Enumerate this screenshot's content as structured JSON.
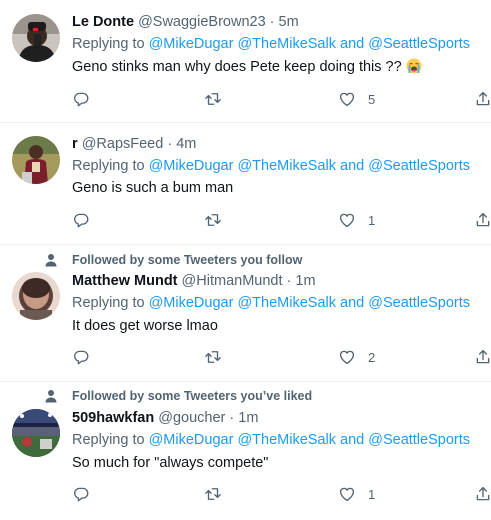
{
  "tweets": [
    {
      "social": "",
      "name": "Le Donte",
      "handle": "@SwaggieBrown23",
      "time": "5m",
      "replying_prefix": "Replying to",
      "mentions": [
        "@MikeDugar",
        "@TheMikeSalk"
      ],
      "and_word": "and",
      "last_mention": "@SeattleSports",
      "text": "Geno stinks man why does Pete keep doing this ??",
      "emoji": "loudly-crying-face",
      "reply_count": "",
      "retweet_count": "",
      "like_count": "5"
    },
    {
      "social": "",
      "name": "r",
      "handle": "@RapsFeed",
      "time": "4m",
      "replying_prefix": "Replying to",
      "mentions": [
        "@MikeDugar",
        "@TheMikeSalk"
      ],
      "and_word": "and",
      "last_mention": "@SeattleSports",
      "text": "Geno is such a bum man",
      "reply_count": "",
      "retweet_count": "",
      "like_count": "1"
    },
    {
      "social": "Followed by some Tweeters you follow",
      "name": "Matthew Mundt",
      "handle": "@HitmanMundt",
      "time": "1m",
      "replying_prefix": "Replying to",
      "mentions": [
        "@MikeDugar",
        "@TheMikeSalk"
      ],
      "and_word": "and",
      "last_mention": "@SeattleSports",
      "text": "It does get worse lmao",
      "reply_count": "",
      "retweet_count": "",
      "like_count": "2"
    },
    {
      "social": "Followed by some Tweeters you’ve liked",
      "name": "509hawkfan",
      "handle": "@goucher",
      "time": "1m",
      "replying_prefix": "Replying to",
      "mentions": [
        "@MikeDugar",
        "@TheMikeSalk"
      ],
      "and_word": "and",
      "last_mention": "@SeattleSports",
      "text": "So much for \"always compete\"",
      "reply_count": "",
      "retweet_count": "",
      "like_count": "1"
    }
  ],
  "separator": "·",
  "icons": {
    "reply": "reply-icon",
    "retweet": "retweet-icon",
    "like": "heart-icon",
    "share": "share-icon",
    "social_context": "person-icon"
  },
  "colors": {
    "link": "#1d9bf0",
    "secondary_text": "#536471",
    "primary_text": "#0f1419",
    "divider": "#eff3f4"
  }
}
